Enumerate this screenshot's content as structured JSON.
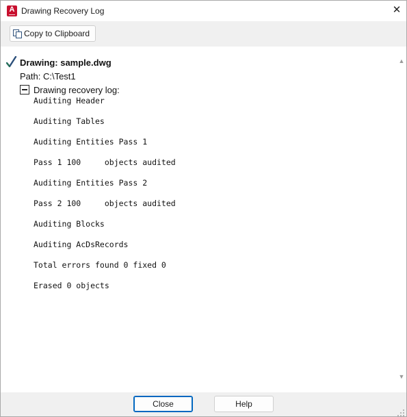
{
  "window": {
    "title": "Drawing Recovery Log",
    "app_icon_letter": "A",
    "accent_color": "#c8102e"
  },
  "toolbar": {
    "copy_label": "Copy to Clipboard"
  },
  "report": {
    "drawing_title": "Drawing: sample.dwg",
    "path_line": "Path: C:\\Test1",
    "log_heading": "Drawing recovery log:",
    "lines": [
      "Auditing Header",
      "Auditing Tables",
      "Auditing Entities Pass 1",
      "Pass 1 100     objects audited",
      "Auditing Entities Pass 2",
      "Pass 2 100     objects audited",
      "Auditing Blocks",
      "Auditing AcDsRecords",
      "Total errors found 0 fixed 0",
      "Erased 0 objects"
    ]
  },
  "footer": {
    "close_label": "Close",
    "help_label": "Help"
  },
  "icons": {
    "check": "check-icon",
    "collapse": "collapse-icon",
    "copy": "copy-icon",
    "close": "close-icon"
  }
}
